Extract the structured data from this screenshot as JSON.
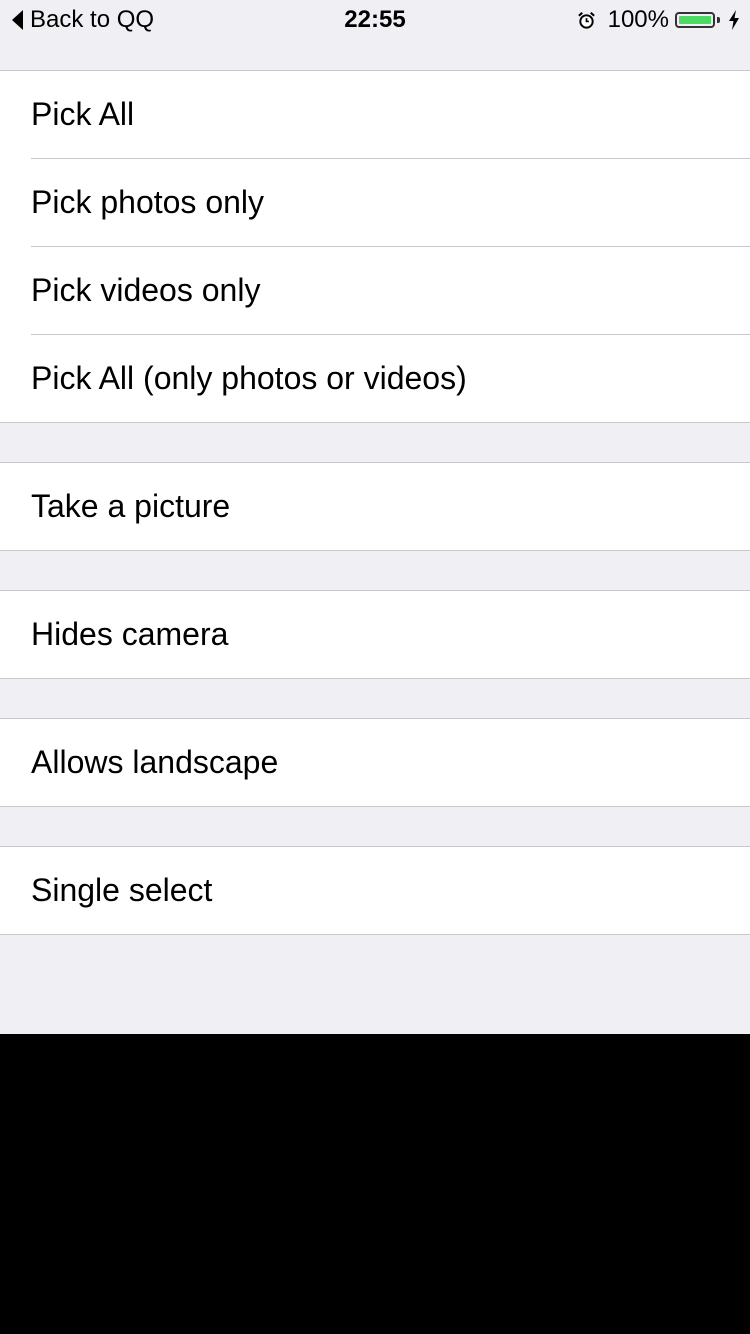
{
  "statusbar": {
    "back_label": "Back to QQ",
    "time": "22:55",
    "battery_percent": "100%",
    "battery_level": 1.0,
    "battery_color": "#4cd964"
  },
  "groups": [
    {
      "rows": [
        {
          "label": "Pick All"
        },
        {
          "label": "Pick photos only"
        },
        {
          "label": "Pick videos only"
        },
        {
          "label": "Pick All (only photos or videos)"
        }
      ]
    },
    {
      "rows": [
        {
          "label": "Take a picture"
        }
      ]
    },
    {
      "rows": [
        {
          "label": "Hides camera"
        }
      ]
    },
    {
      "rows": [
        {
          "label": "Allows landscape"
        }
      ]
    },
    {
      "rows": [
        {
          "label": "Single select"
        }
      ]
    }
  ],
  "colors": {
    "background": "#efeff4",
    "separator": "#c8c7cc",
    "cell": "#ffffff",
    "text": "#000000"
  }
}
